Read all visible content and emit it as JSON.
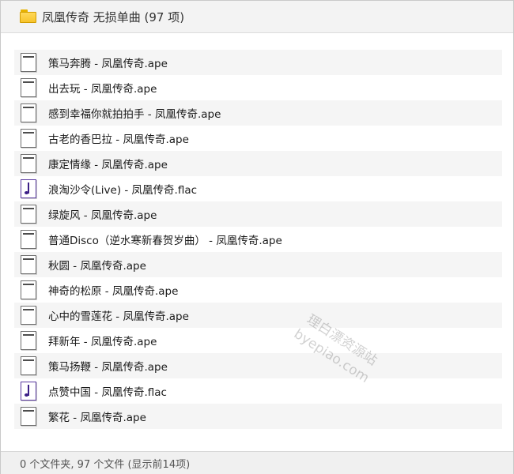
{
  "window": {
    "title": "凤凰传奇 无损单曲 (97 项)",
    "folder_icon": "folder-icon"
  },
  "files": [
    {
      "name": "策马奔腾 - 凤凰传奇.ape",
      "icon": "ape-file-icon"
    },
    {
      "name": "出去玩 - 凤凰传奇.ape",
      "icon": "ape-file-icon"
    },
    {
      "name": "感到幸福你就拍拍手 - 凤凰传奇.ape",
      "icon": "ape-file-icon"
    },
    {
      "name": "古老的香巴拉 - 凤凰传奇.ape",
      "icon": "ape-file-icon"
    },
    {
      "name": "康定情缘 - 凤凰传奇.ape",
      "icon": "ape-file-icon"
    },
    {
      "name": "浪淘沙令(Live) - 凤凰传奇.flac",
      "icon": "flac-file-icon"
    },
    {
      "name": "绿旋风 - 凤凰传奇.ape",
      "icon": "ape-file-icon"
    },
    {
      "name": "普通Disco（逆水寒新春贺岁曲） - 凤凰传奇.ape",
      "icon": "ape-file-icon"
    },
    {
      "name": "秋圆 - 凤凰传奇.ape",
      "icon": "ape-file-icon"
    },
    {
      "name": "神奇的松原 - 凤凰传奇.ape",
      "icon": "ape-file-icon"
    },
    {
      "name": "心中的雪莲花 - 凤凰传奇.ape",
      "icon": "ape-file-icon"
    },
    {
      "name": "拜新年 - 凤凰传奇.ape",
      "icon": "ape-file-icon"
    },
    {
      "name": "策马扬鞭 - 凤凰传奇.ape",
      "icon": "ape-file-icon"
    },
    {
      "name": "点赞中国 - 凤凰传奇.flac",
      "icon": "flac-file-icon"
    },
    {
      "name": "繁花 - 凤凰传奇.ape",
      "icon": "ape-file-icon"
    }
  ],
  "watermark": {
    "line1": "理白漂资源站",
    "line2": "byepiao.com"
  },
  "status": {
    "text": "0 个文件夹, 97 个文件 (显示前14项)"
  }
}
